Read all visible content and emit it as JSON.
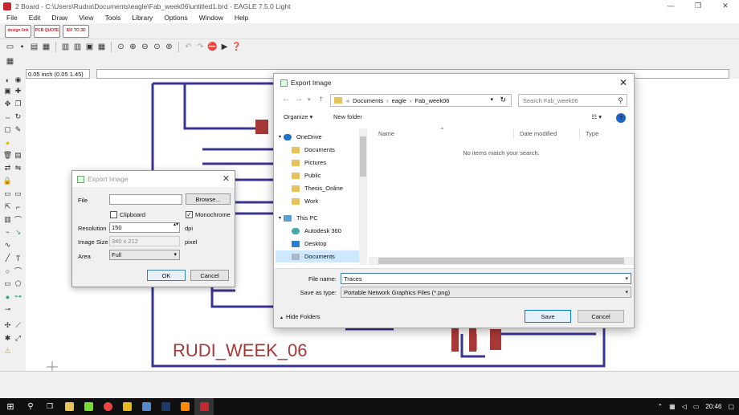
{
  "window": {
    "title": "2 Board - C:\\Users\\Rudra\\Documents\\eagle\\Fab_week06\\untitled1.brd - EAGLE 7.5.0 Light",
    "minimize": "—",
    "restore": "❐",
    "close": "✕"
  },
  "menu": [
    "File",
    "Edit",
    "Draw",
    "View",
    "Tools",
    "Library",
    "Options",
    "Window",
    "Help"
  ],
  "vendor_buttons": [
    {
      "label": "design link"
    },
    {
      "label": "PCB QUOTE"
    },
    {
      "label": "IDF TO 3D"
    }
  ],
  "coord": {
    "value": "0.05 inch (0.05 1.45)"
  },
  "board": {
    "label": "RUDI_WEEK_06"
  },
  "small_dialog": {
    "title": "Export Image",
    "close": "✕",
    "file_label": "File",
    "file_value": "",
    "browse_label": "Browse...",
    "clipboard_label": "Clipboard",
    "clipboard_checked": false,
    "monochrome_label": "Monochrome",
    "monochrome_checked": true,
    "resolution_label": "Resolution",
    "resolution_value": "150",
    "resolution_unit": "dpi",
    "image_size_label": "Image Size",
    "image_size_value": "340 x 212",
    "image_size_unit": "pixel",
    "area_label": "Area",
    "area_value": "Full",
    "ok_label": "OK",
    "cancel_label": "Cancel"
  },
  "file_dialog": {
    "title": "Export Image",
    "close": "✕",
    "breadcrumb_prefix": "«",
    "breadcrumb": [
      "Documents",
      "eagle",
      "Fab_week06"
    ],
    "search_placeholder": "Search Fab_week06",
    "organize_label": "Organize ▾",
    "new_folder_label": "New folder",
    "help": "?",
    "nav_items": [
      {
        "label": "OneDrive",
        "icon": "cloud-icon"
      },
      {
        "label": "Documents",
        "icon": "folder-icon"
      },
      {
        "label": "Pictures",
        "icon": "folder-icon"
      },
      {
        "label": "Public",
        "icon": "folder-icon"
      },
      {
        "label": "Thesis_Online",
        "icon": "folder-icon"
      },
      {
        "label": "Work",
        "icon": "folder-icon"
      },
      {
        "label": "This PC",
        "icon": "computer-icon"
      },
      {
        "label": "Autodesk 360",
        "icon": "autodesk-icon"
      },
      {
        "label": "Desktop",
        "icon": "desktop-icon"
      },
      {
        "label": "Documents",
        "icon": "documents-icon"
      }
    ],
    "columns": [
      "Name",
      "Date modified",
      "Type"
    ],
    "empty_message": "No items match your search.",
    "file_name_label": "File name:",
    "file_name_value": "Traces",
    "save_type_label": "Save as type:",
    "save_type_value": "Portable Network Graphics Files (*.png)",
    "hide_folders_label": "Hide Folders",
    "save_label": "Save",
    "cancel_label": "Cancel"
  },
  "taskbar": {
    "time": "20:46"
  },
  "colors": {
    "trace": "#3a3591",
    "pad": "#a83838",
    "accent": "#0078d7"
  }
}
